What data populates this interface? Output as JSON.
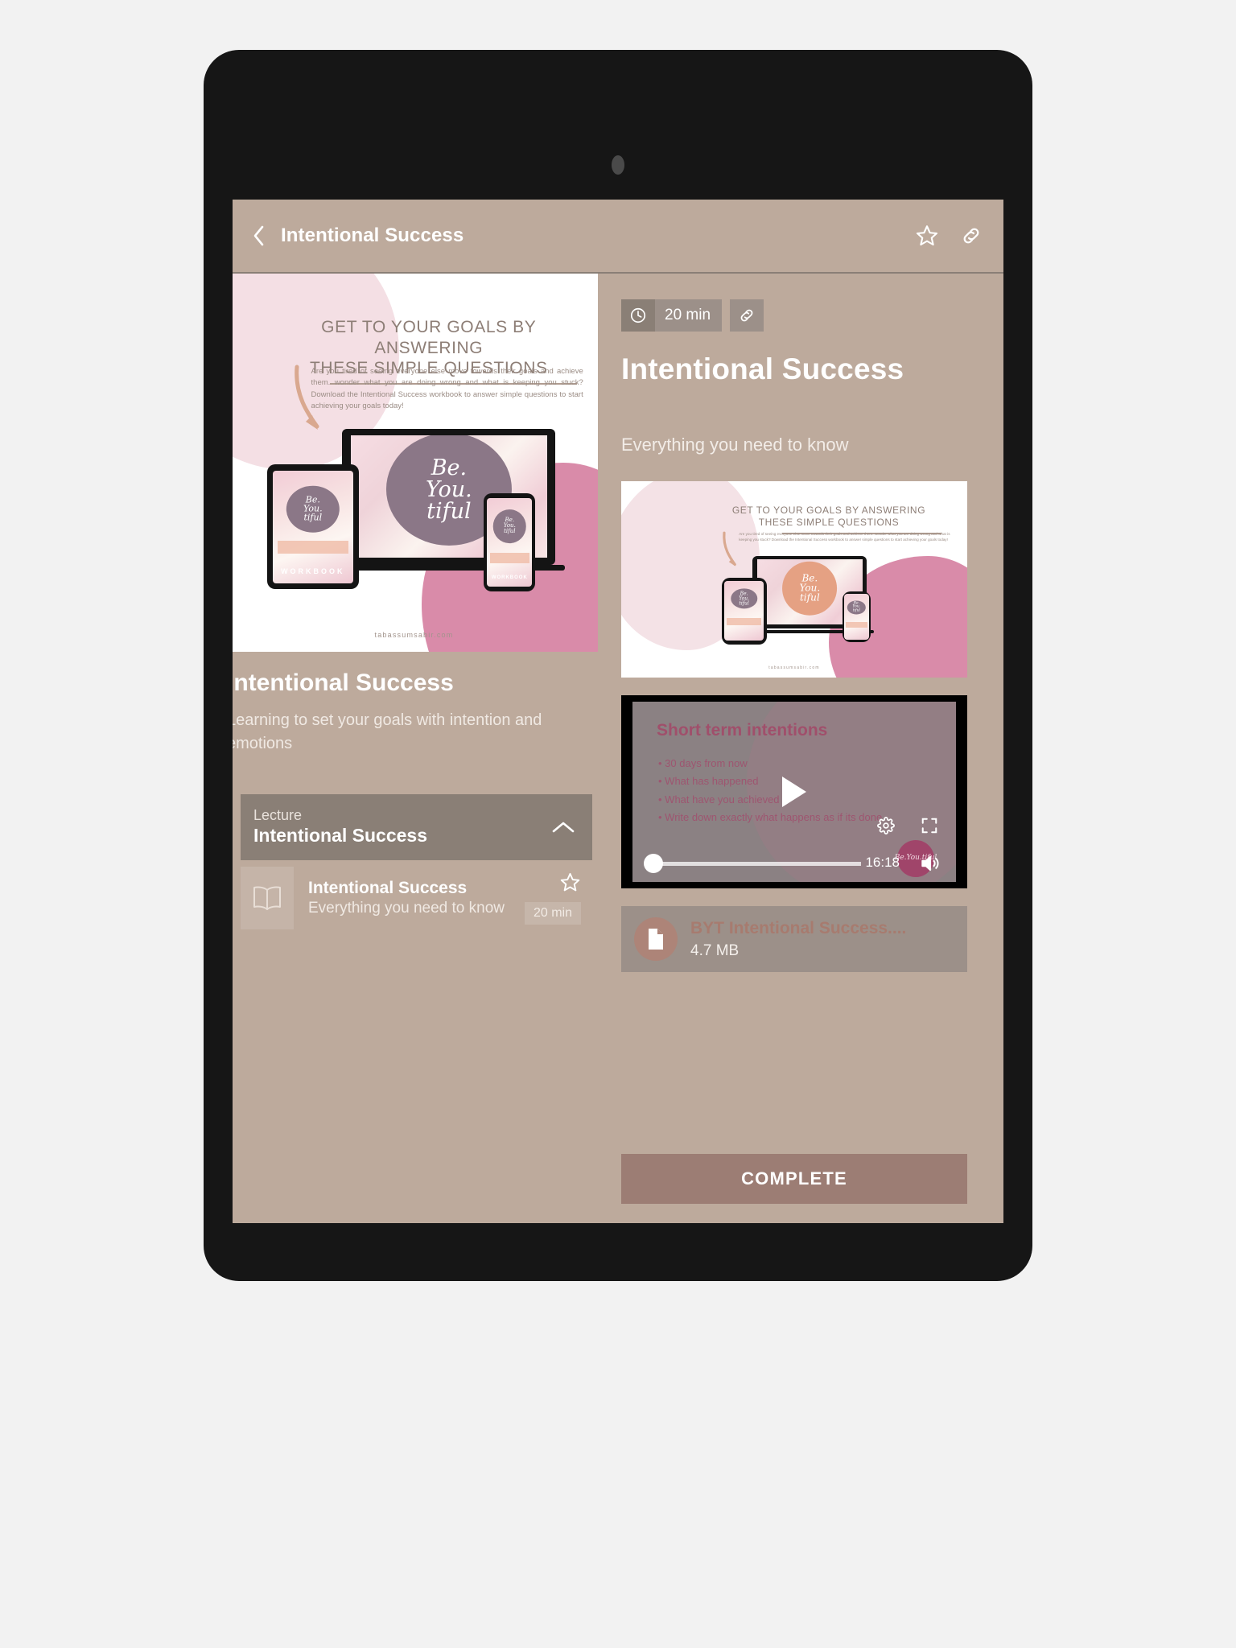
{
  "app": {
    "bar": {
      "back_icon": "chevron-left-icon",
      "title": "Intentional Success",
      "favorite_icon": "star-outline-icon",
      "share_icon": "link-icon"
    }
  },
  "left_pane": {
    "course_title": "Intentional Success",
    "course_subtitle": "Learning to set your goals with intention and emotions",
    "section": {
      "label": "Lecture",
      "title": "Intentional Success",
      "collapse_icon": "chevron-up-icon"
    },
    "items": [
      {
        "icon": "book-icon",
        "title": "Intentional Success",
        "subtitle": "Everything you need to know",
        "favorite_icon": "star-outline-icon",
        "duration": "20 min"
      }
    ]
  },
  "right_pane": {
    "duration_chip": {
      "icon": "clock-icon",
      "text": "20 min"
    },
    "link_chip_icon": "link-icon",
    "lesson_title": "Intentional Success",
    "lesson_subtitle": "Everything you need to know",
    "video": {
      "play_icon": "play-icon",
      "settings_icon": "gear-icon",
      "fullscreen_icon": "fullscreen-icon",
      "volume_icon": "volume-icon",
      "time": "16:18",
      "progress_percent": 0,
      "slide": {
        "heading": "Short term intentions",
        "bullets": [
          "30 days from now",
          "What has happened",
          "What have you achieved",
          "Write down exactly what happens as if its done"
        ]
      },
      "watermark": "Be.You.tiful"
    },
    "attachment": {
      "icon": "document-icon",
      "name": "BYT Intentional Success....",
      "size": "4.7 MB"
    },
    "complete_label": "COMPLETE"
  },
  "artwork": {
    "headline_line1": "GET TO YOUR GOALS BY  ANSWERING",
    "headline_line2": "THESE SIMPLE QUESTIONS",
    "paragraph": "Are you tired of seeing everyone else move towards their goals and achieve them.   wonder what you are doing wrong and what is keeping you stuck? Download the Intentional Success workbook to answer simple questions    to start achieving your goals today!",
    "logo_line1": "Be.",
    "logo_line2": "You.",
    "logo_line3": "tiful",
    "workbook_word": "WORKBOOK",
    "site": "tabassumsabir.com"
  },
  "colors": {
    "bezel": "#161616",
    "app_bg": "#bdaa9c",
    "panel": "#9c9089",
    "section": "#8a7f76",
    "accent_button": "#9c7d74",
    "attachment_icon": "#ad8478",
    "page_bg": "#f2f2f2"
  }
}
